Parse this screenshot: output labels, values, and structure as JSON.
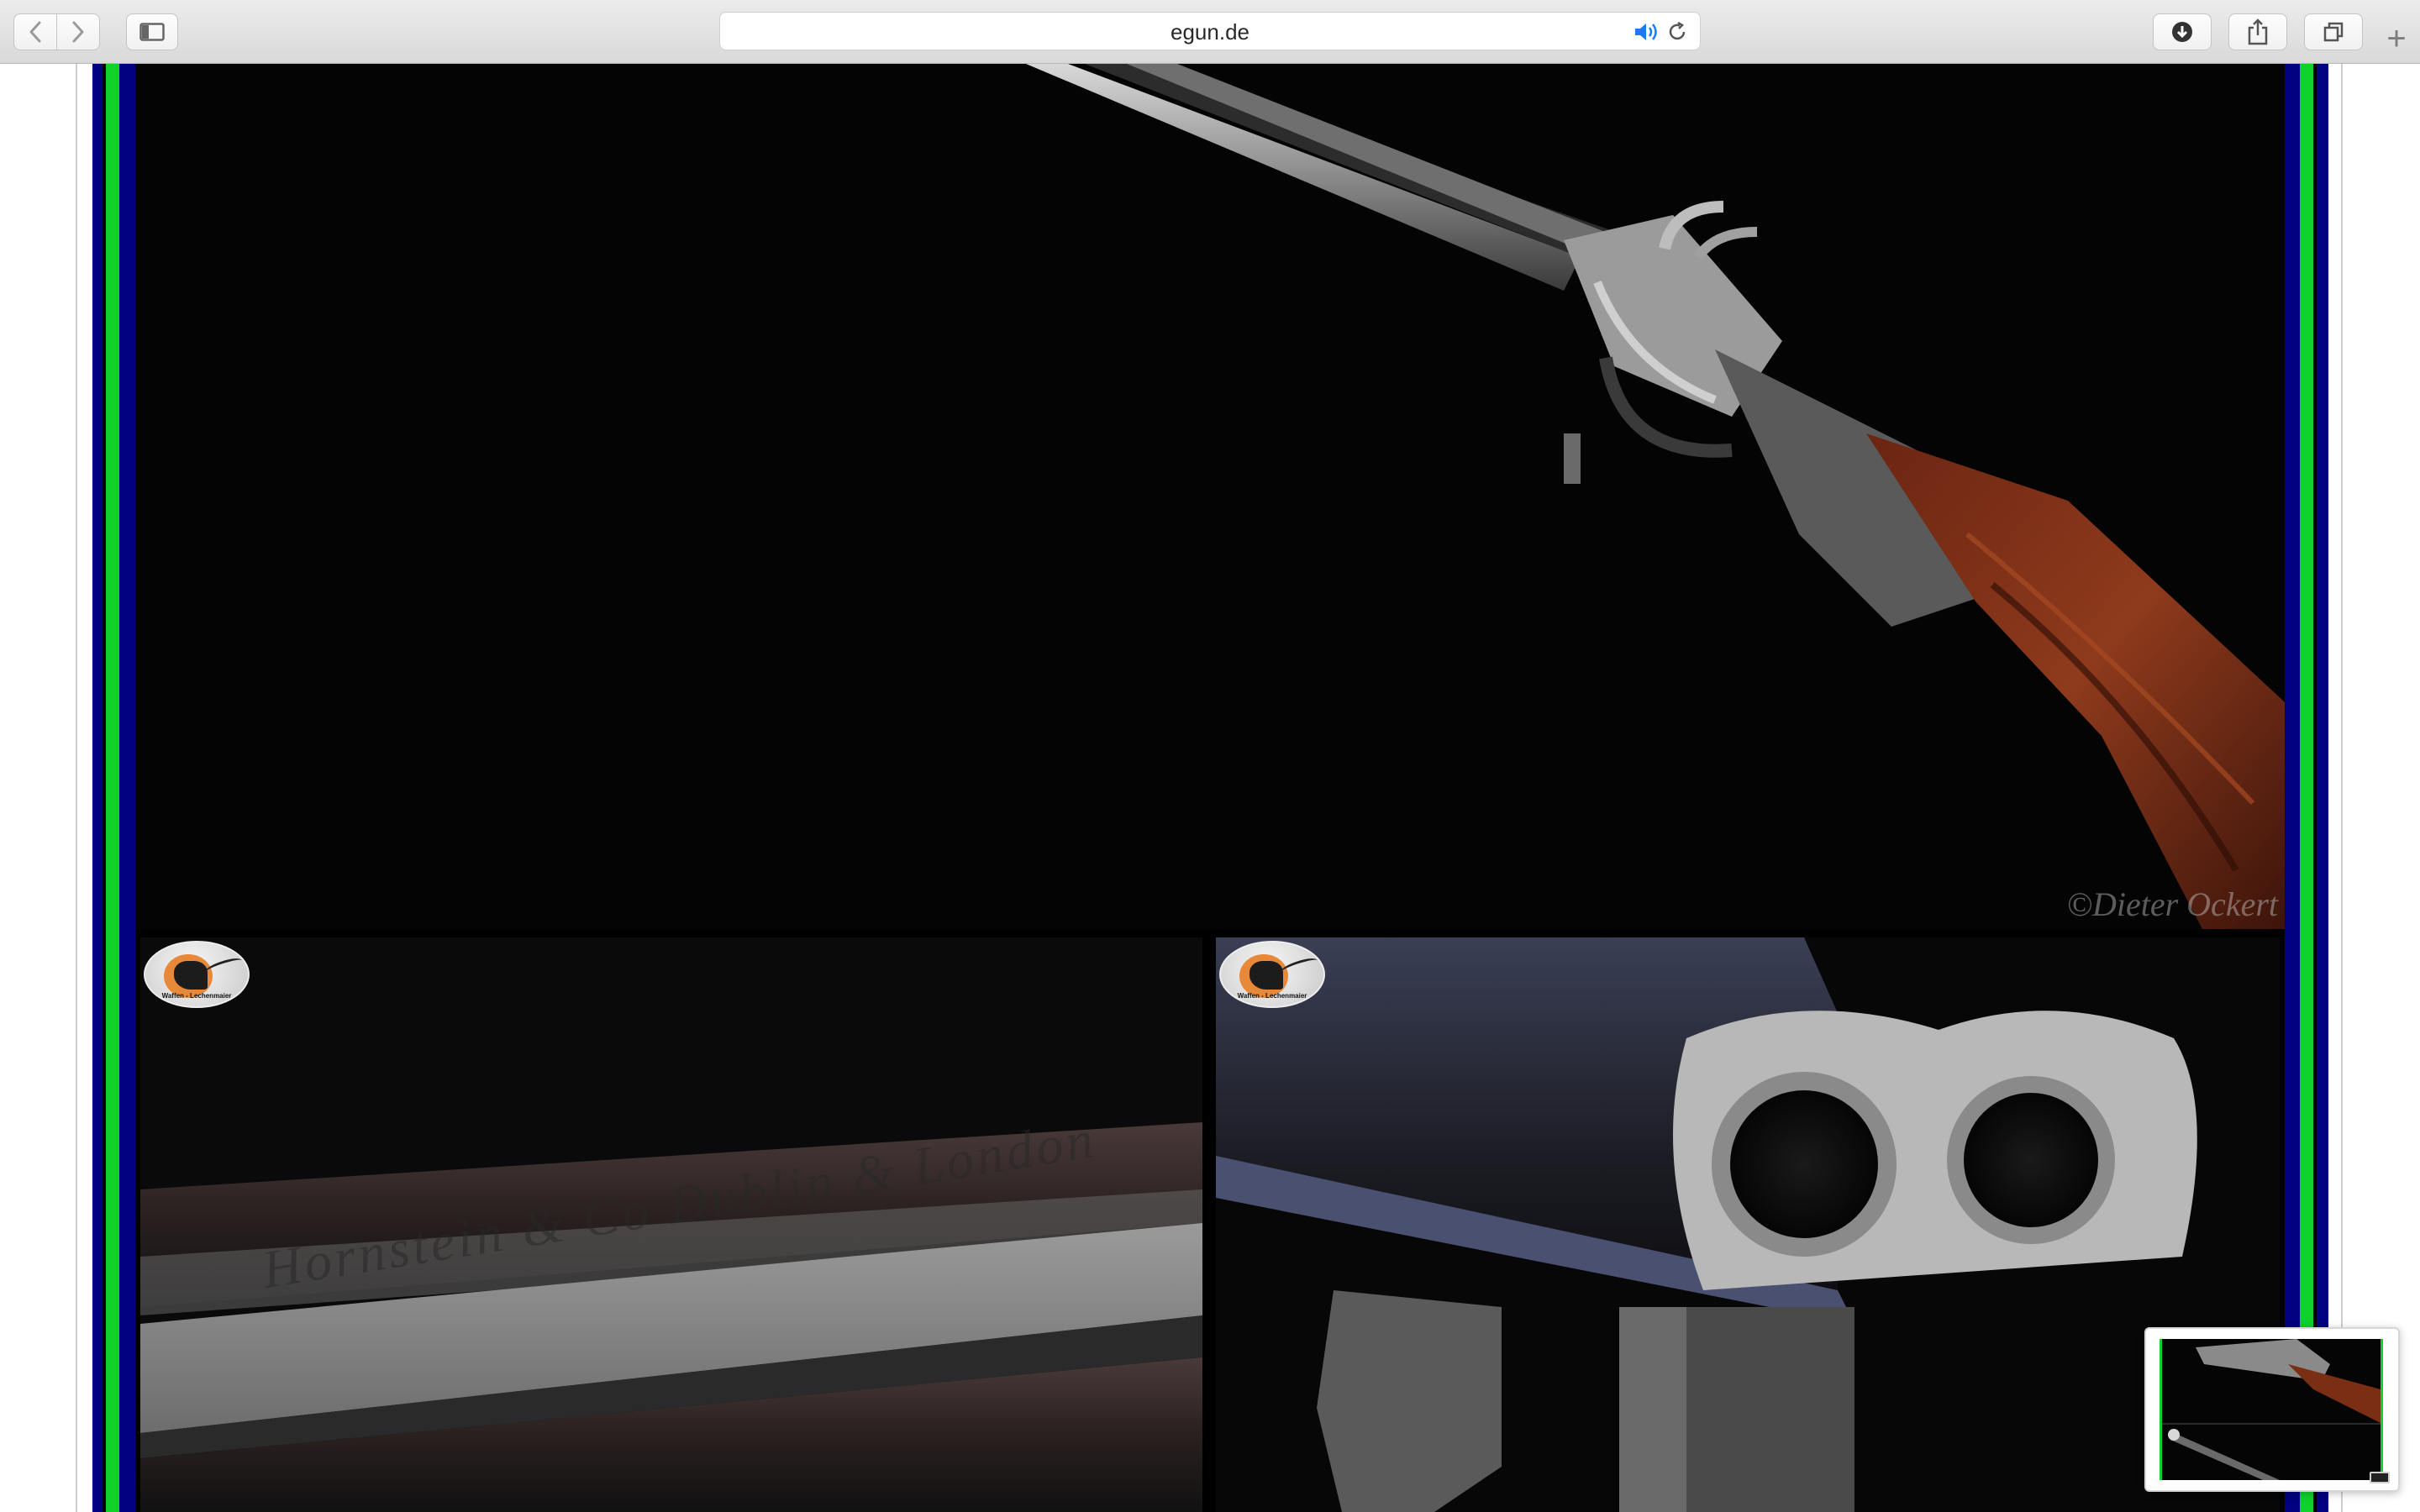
{
  "browser": {
    "url": "egun.de",
    "new_tab_label": "+",
    "icons": {
      "back": "chevron-left-icon",
      "forward": "chevron-right-icon",
      "sidebar": "sidebar-icon",
      "audio": "speaker-icon",
      "reload": "reload-icon",
      "downloads": "download-icon",
      "share": "share-icon",
      "tabs": "tab-overview-icon"
    },
    "accent": "#1a7cf5"
  },
  "page": {
    "border_colors": {
      "outer": "#000080",
      "inner": "#10d02a",
      "background": "#000000"
    },
    "photos": {
      "main_watermark": "©Dieter Ockert",
      "barrel_engraving": "Hornstein & Co Dublin & London",
      "logo_text_top": "Jagd & Schiesssport",
      "logo_text_bottom": "Waffen - Lechenmaier"
    }
  }
}
